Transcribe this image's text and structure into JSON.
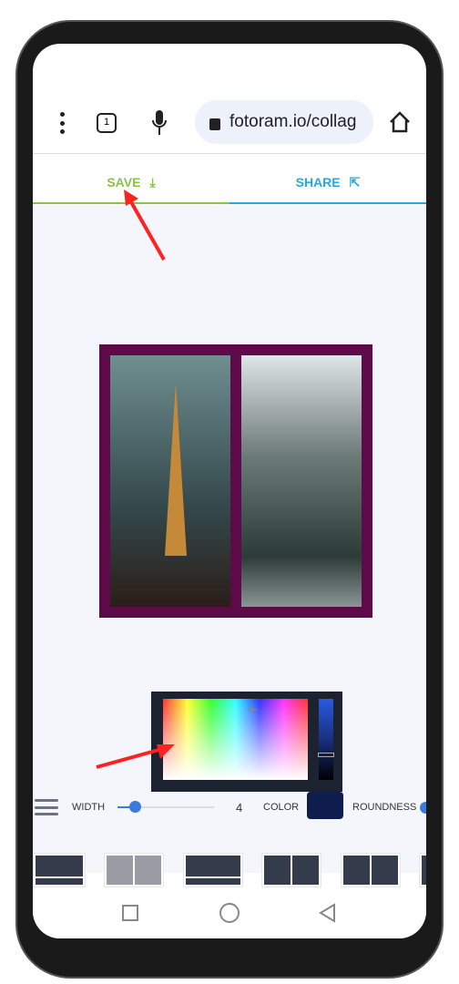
{
  "browser": {
    "url": "fotoram.io/collag",
    "tab_count": "1"
  },
  "tabs": {
    "save": "SAVE",
    "share": "SHARE"
  },
  "colors": {
    "save": "#8bc34a",
    "share": "#29a8e0",
    "frame": "#5e0a48",
    "picker_bg": "#1c2230",
    "selected_color": "#0f1d4e",
    "slider": "#3b7be0"
  },
  "toolbar": {
    "width_label": "WIDTH",
    "width_value": "4",
    "color_label": "COLOR",
    "roundness_label": "ROUNDNESS",
    "width_fraction": 0.1
  },
  "icons": [
    "menu-icon",
    "tabs-icon",
    "mic-icon",
    "lock-icon",
    "home-icon",
    "download-icon",
    "share-icon",
    "hamburger-icon",
    "square-icon",
    "circle-icon",
    "back-icon"
  ]
}
